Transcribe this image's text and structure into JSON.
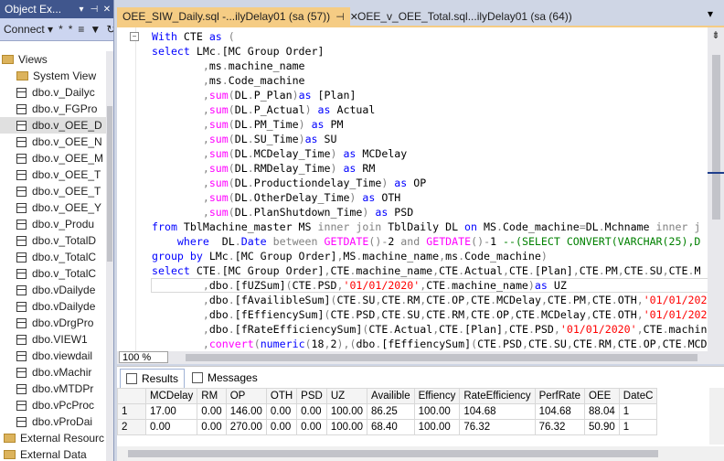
{
  "object_explorer": {
    "title": "Object Ex...",
    "title_buttons": [
      "▾",
      "⊣",
      "✕"
    ],
    "connect_label": "Connect ▾",
    "toolbar_icons": [
      "*",
      "*",
      "≡",
      "▼",
      "↻",
      "⊸"
    ],
    "items": [
      {
        "label": "Views",
        "type": "folder-open"
      },
      {
        "label": "System View",
        "type": "folder"
      },
      {
        "label": "dbo.v_Dailyc",
        "type": "view"
      },
      {
        "label": "dbo.v_FGPro",
        "type": "view"
      },
      {
        "label": "dbo.v_OEE_D",
        "type": "view"
      },
      {
        "label": "dbo.v_OEE_N",
        "type": "view"
      },
      {
        "label": "dbo.v_OEE_M",
        "type": "view"
      },
      {
        "label": "dbo.v_OEE_T",
        "type": "view"
      },
      {
        "label": "dbo.v_OEE_T",
        "type": "view"
      },
      {
        "label": "dbo.v_OEE_Y",
        "type": "view"
      },
      {
        "label": "dbo.v_Produ",
        "type": "view"
      },
      {
        "label": "dbo.v_TotalD",
        "type": "view"
      },
      {
        "label": "dbo.v_TotalC",
        "type": "view"
      },
      {
        "label": "dbo.v_TotalC",
        "type": "view"
      },
      {
        "label": "dbo.vDailyde",
        "type": "view"
      },
      {
        "label": "dbo.vDailyde",
        "type": "view"
      },
      {
        "label": "dbo.vDrgPro",
        "type": "view"
      },
      {
        "label": "dbo.VIEW1",
        "type": "view"
      },
      {
        "label": "dbo.viewdail",
        "type": "view"
      },
      {
        "label": "dbo.vMachir",
        "type": "view"
      },
      {
        "label": "dbo.vMTDPr",
        "type": "view"
      },
      {
        "label": "dbo.vPcProc",
        "type": "view"
      },
      {
        "label": "dbo.vProDai",
        "type": "view"
      },
      {
        "label": "External Resourc",
        "type": "folder"
      },
      {
        "label": "External Data",
        "type": "folder"
      }
    ]
  },
  "tabs": [
    {
      "label": "OEE_SIW_Daily.sql -...ilyDelay01 (sa (57))",
      "close": "✕",
      "pin": "⊣"
    },
    {
      "label": "OEE_v_OEE_Total.sql...ilyDelay01 (sa (64))"
    }
  ],
  "tab_overflow": "▾",
  "editor": {
    "split_glyph": "⇟",
    "collapse_glyph": "−"
  },
  "zoom": "100 %",
  "results_tabs": {
    "results": "Results",
    "messages": "Messages"
  },
  "grid": {
    "columns": [
      "MCDelay",
      "RM",
      "OP",
      "OTH",
      "PSD",
      "UZ",
      "Availible",
      "Effiency",
      "RateEfficiency",
      "PerfRate",
      "OEE",
      "DateC"
    ],
    "rows": [
      {
        "n": "1",
        "cells": [
          "17.00",
          "0.00",
          "146.00",
          "0.00",
          "0.00",
          "100.00",
          "86.25",
          "100.00",
          "104.68",
          "104.68",
          "88.04",
          "1"
        ]
      },
      {
        "n": "2",
        "cells": [
          "0.00",
          "0.00",
          "270.00",
          "0.00",
          "0.00",
          "100.00",
          "68.40",
          "100.00",
          "76.32",
          "76.32",
          "50.90",
          "1"
        ]
      }
    ]
  },
  "colors": {
    "accent": "#f5cc84",
    "titlebar": "#40568d",
    "keyword": "#0000ff",
    "function": "#ff00ff",
    "string": "#ff0000",
    "comment": "#008000",
    "operator": "#808080"
  }
}
